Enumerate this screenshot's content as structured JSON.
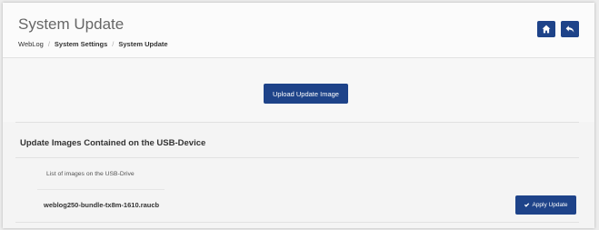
{
  "header": {
    "title": "System Update",
    "breadcrumb": [
      "WebLog",
      "System Settings",
      "System Update"
    ],
    "buttons": {
      "home_icon": "home-icon",
      "back_icon": "back-icon"
    }
  },
  "upload": {
    "button_label": "Upload Update Image"
  },
  "usb_section": {
    "title": "Update Images Contained on the USB-Device",
    "list_header": "List of images on the USB-Drive",
    "images": [
      {
        "name": "weblog250-bundle-tx8m-1610.raucb",
        "action_label": "Apply Update",
        "action_icon": "check-icon"
      }
    ]
  },
  "colors": {
    "accent": "#1e4389",
    "background": "#f4f4f4"
  }
}
